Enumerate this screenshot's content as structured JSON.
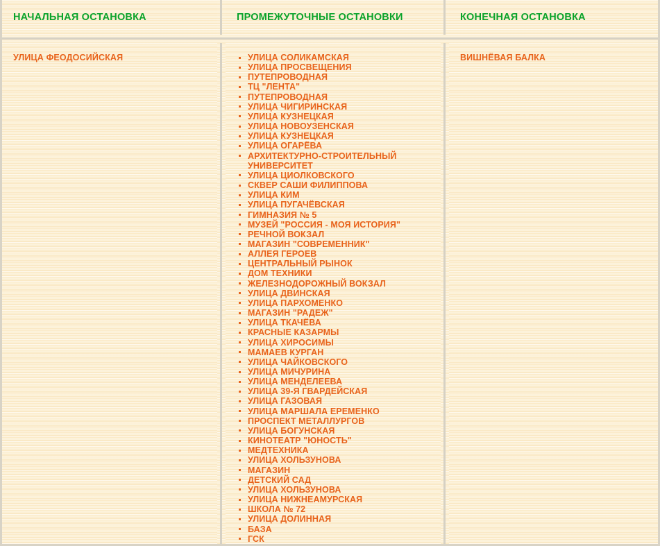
{
  "colors": {
    "header_green": "#0aa32b",
    "body_orange": "#e8631b",
    "paper_bg": "#fcefd2",
    "border_gray": "#d6d1c4"
  },
  "table": {
    "headers": [
      "НАЧАЛЬНАЯ ОСТАНОВКА",
      "ПРОМЕЖУТОЧНЫЕ ОСТАНОВКИ",
      "КОНЕЧНАЯ ОСТАНОВКА"
    ],
    "start_stop": "УЛИЦА ФЕОДОСИЙСКАЯ",
    "end_stop": "ВИШНЁВАЯ БАЛКА",
    "intermediate_stops": [
      "УЛИЦА СОЛИКАМСКАЯ",
      "УЛИЦА ПРОСВЕЩЕНИЯ",
      "ПУТЕПРОВОДНАЯ",
      "ТЦ \"ЛЕНТА\"",
      "ПУТЕПРОВОДНАЯ",
      "УЛИЦА ЧИГИРИНСКАЯ",
      "УЛИЦА КУЗНЕЦКАЯ",
      "УЛИЦА НОВОУЗЕНСКАЯ",
      "УЛИЦА КУЗНЕЦКАЯ",
      "УЛИЦА ОГАРЁВА",
      "АРХИТЕКТУРНО-СТРОИТЕЛЬНЫЙ УНИВЕРСИТЕТ",
      "УЛИЦА ЦИОЛКОВСКОГО",
      "СКВЕР САШИ ФИЛИППОВА",
      "УЛИЦА КИМ",
      "УЛИЦА ПУГАЧЁВСКАЯ",
      "ГИМНАЗИЯ № 5",
      "МУЗЕЙ \"РОССИЯ - МОЯ ИСТОРИЯ\"",
      "РЕЧНОЙ ВОКЗАЛ",
      "МАГАЗИН \"СОВРЕМЕННИК\"",
      "АЛЛЕЯ ГЕРОЕВ",
      "ЦЕНТРАЛЬНЫЙ РЫНОК",
      "ДОМ ТЕХНИКИ",
      "ЖЕЛЕЗНОДОРОЖНЫЙ ВОКЗАЛ",
      "УЛИЦА ДВИНСКАЯ",
      "УЛИЦА ПАРХОМЕНКО",
      "МАГАЗИН \"РАДЕЖ\"",
      "УЛИЦА ТКАЧЁВА",
      "КРАСНЫЕ КАЗАРМЫ",
      "УЛИЦА ХИРОСИМЫ",
      "МАМАЕВ КУРГАН",
      "УЛИЦА ЧАЙКОВСКОГО",
      "УЛИЦА МИЧУРИНА",
      "УЛИЦА МЕНДЕЛЕЕВА",
      "УЛИЦА 39-Я ГВАРДЕЙСКАЯ",
      "УЛИЦА ГАЗОВАЯ",
      "УЛИЦА МАРШАЛА ЕРЕМЕНКО",
      "ПРОСПЕКТ МЕТАЛЛУРГОВ",
      "УЛИЦА БОГУНСКАЯ",
      "КИНОТЕАТР \"ЮНОСТЬ\"",
      "МЕДТЕХНИКА",
      "УЛИЦА ХОЛЬЗУНОВА",
      "МАГАЗИН",
      "ДЕТСКИЙ САД",
      "УЛИЦА ХОЛЬЗУНОВА",
      "УЛИЦА НИЖНЕАМУРСКАЯ",
      "ШКОЛА № 72",
      "УЛИЦА ДОЛИННАЯ",
      "БАЗА",
      "ГСК"
    ]
  }
}
